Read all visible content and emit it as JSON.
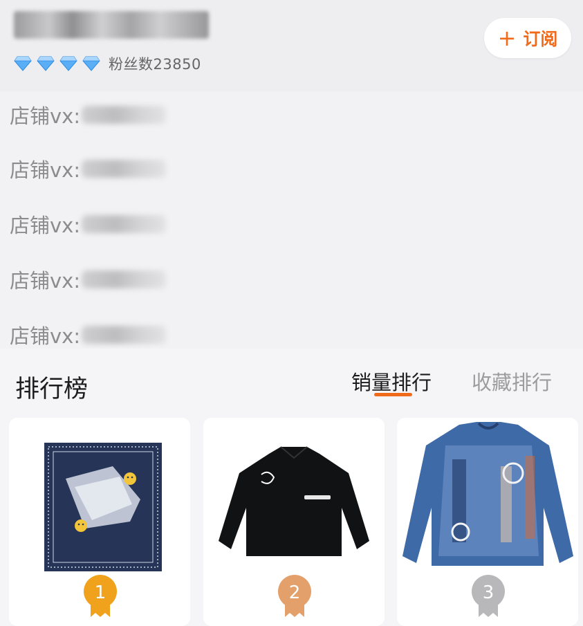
{
  "header": {
    "fans_text": "粉丝数23850",
    "subscribe_label": "订阅",
    "plus_symbol": "+",
    "level_diamonds": 4,
    "diamond_icon": "diamond-icon"
  },
  "contacts": {
    "items": [
      {
        "label": "店铺vx:"
      },
      {
        "label": "店铺vx:"
      },
      {
        "label": "店铺vx:"
      },
      {
        "label": "店铺vx:"
      },
      {
        "label": "店铺vx:"
      }
    ]
  },
  "ranking": {
    "title": "排行榜",
    "tabs": [
      {
        "label": "销量排行",
        "active": true
      },
      {
        "label": "收藏排行",
        "active": false
      }
    ],
    "products": [
      {
        "rank": "1",
        "medal_color": "#f0a21c",
        "image": "bandana-image"
      },
      {
        "rank": "2",
        "medal_color": "#e3a06a",
        "image": "black-fleece-jacket-image"
      },
      {
        "rank": "3",
        "medal_color": "#b8b8ba",
        "image": "colorful-knit-sweater-image"
      }
    ]
  },
  "colors": {
    "accent": "#f06a1a",
    "diamond": "#5aaef5"
  }
}
